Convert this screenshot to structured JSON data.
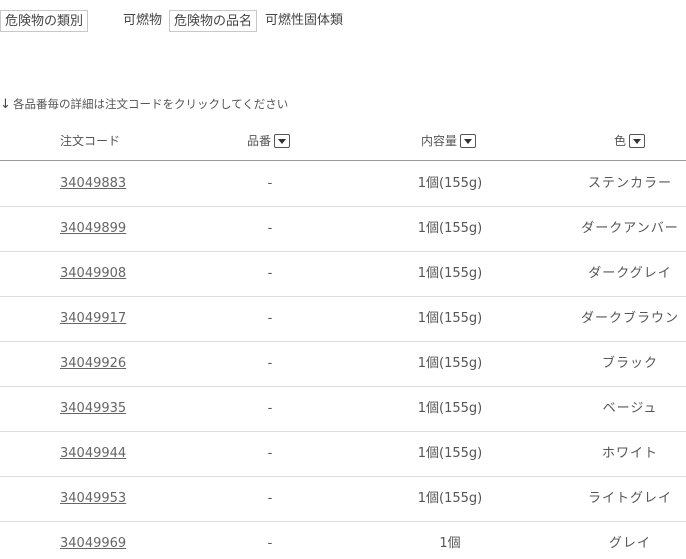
{
  "hazard": {
    "category_label": "危険物の類別",
    "category_value": "可燃物",
    "name_label": "危険物の品名",
    "name_value": "可燃性固体類"
  },
  "note": {
    "icon": "arrow-down-icon",
    "text": "各品番毎の詳細は注文コードをクリックしてください"
  },
  "table": {
    "headers": {
      "code": "注文コード",
      "hinban": "品番",
      "volume": "内容量",
      "color": "色"
    },
    "rows": [
      {
        "code": "34049883",
        "hinban": "-",
        "volume": "1個(155g)",
        "color": "ステンカラー"
      },
      {
        "code": "34049899",
        "hinban": "-",
        "volume": "1個(155g)",
        "color": "ダークアンバー"
      },
      {
        "code": "34049908",
        "hinban": "-",
        "volume": "1個(155g)",
        "color": "ダークグレイ"
      },
      {
        "code": "34049917",
        "hinban": "-",
        "volume": "1個(155g)",
        "color": "ダークブラウン"
      },
      {
        "code": "34049926",
        "hinban": "-",
        "volume": "1個(155g)",
        "color": "ブラック"
      },
      {
        "code": "34049935",
        "hinban": "-",
        "volume": "1個(155g)",
        "color": "ベージュ"
      },
      {
        "code": "34049944",
        "hinban": "-",
        "volume": "1個(155g)",
        "color": "ホワイト"
      },
      {
        "code": "34049953",
        "hinban": "-",
        "volume": "1個(155g)",
        "color": "ライトグレイ"
      },
      {
        "code": "34049969",
        "hinban": "-",
        "volume": "1個",
        "color": "グレイ"
      }
    ]
  }
}
